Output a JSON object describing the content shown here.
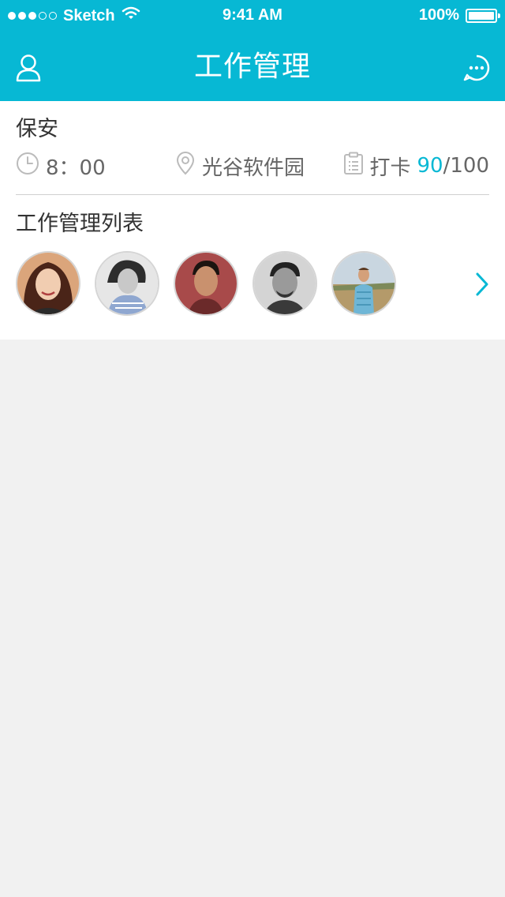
{
  "status_bar": {
    "carrier": "Sketch",
    "time": "9:41 AM",
    "battery": "100%",
    "signal_icon": "signal-dots-icon",
    "wifi_icon": "wifi-icon",
    "battery_icon": "battery-icon"
  },
  "nav": {
    "title": "工作管理",
    "left_icon": "user-icon",
    "right_icon": "chat-bubble-icon"
  },
  "job": {
    "role": "保安",
    "time": "8：00",
    "location": "光谷软件园",
    "checkin_label": "打卡",
    "checkin_done": "90",
    "checkin_total": "/100"
  },
  "work_list": {
    "title": "工作管理列表",
    "avatars": [
      {
        "name": "avatar-1"
      },
      {
        "name": "avatar-2"
      },
      {
        "name": "avatar-3"
      },
      {
        "name": "avatar-4"
      },
      {
        "name": "avatar-5"
      }
    ],
    "more_icon": "chevron-right-icon"
  },
  "colors": {
    "accent": "#07b8d4",
    "text": "#333333",
    "muted": "#666666",
    "background": "#f1f1f1"
  }
}
